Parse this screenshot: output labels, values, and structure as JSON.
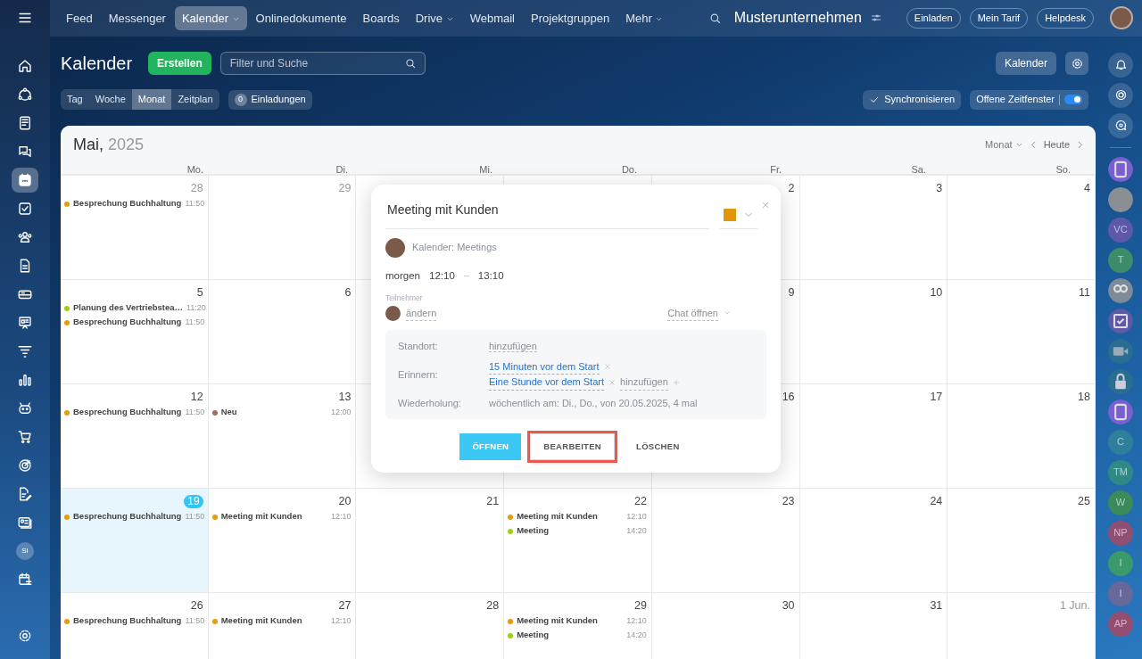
{
  "left_sidebar": {
    "items": [
      {
        "kind": "menu",
        "selected": false
      },
      {
        "kind": "home",
        "selected": false
      },
      {
        "kind": "nodes",
        "selected": false
      },
      {
        "kind": "news",
        "selected": false
      },
      {
        "kind": "chat",
        "selected": false
      },
      {
        "kind": "calendar",
        "selected": true
      },
      {
        "kind": "tasks",
        "selected": false
      },
      {
        "kind": "people",
        "selected": false
      },
      {
        "kind": "document",
        "selected": false
      },
      {
        "kind": "drive",
        "selected": false
      },
      {
        "kind": "board",
        "selected": false
      },
      {
        "kind": "funnel",
        "selected": false
      },
      {
        "kind": "chart",
        "selected": false
      },
      {
        "kind": "robot",
        "selected": false
      },
      {
        "kind": "cart",
        "selected": false
      },
      {
        "kind": "target",
        "selected": false
      },
      {
        "kind": "sign",
        "selected": false
      },
      {
        "kind": "idcard",
        "selected": false
      },
      {
        "kind": "avatar",
        "initials": "SI",
        "selected": false
      },
      {
        "kind": "callist",
        "selected": false
      },
      {
        "kind": "settings",
        "selected": false
      }
    ]
  },
  "top_nav": {
    "items": [
      {
        "label": "Feed",
        "selected": false,
        "dropdown": false
      },
      {
        "label": "Messenger",
        "selected": false,
        "dropdown": false
      },
      {
        "label": "Kalender",
        "selected": true,
        "dropdown": true
      },
      {
        "label": "Onlinedokumente",
        "selected": false,
        "dropdown": false
      },
      {
        "label": "Boards",
        "selected": false,
        "dropdown": false
      },
      {
        "label": "Drive",
        "selected": false,
        "dropdown": true
      },
      {
        "label": "Webmail",
        "selected": false,
        "dropdown": false
      },
      {
        "label": "Projektgruppen",
        "selected": false,
        "dropdown": false
      },
      {
        "label": "Mehr",
        "selected": false,
        "dropdown": true
      }
    ],
    "company": "Musterunternehmen",
    "buttons": [
      "Einladen",
      "Mein Tarif",
      "Helpdesk"
    ]
  },
  "header": {
    "title": "Kalender",
    "create_button": "Erstellen",
    "search": {
      "placeholder": "Filter und Suche"
    },
    "calendar_button": "Kalender"
  },
  "view_tabs": [
    {
      "label": "Tag",
      "selected": false
    },
    {
      "label": "Woche",
      "selected": false
    },
    {
      "label": "Monat",
      "selected": true
    },
    {
      "label": "Zeitplan",
      "selected": false
    }
  ],
  "invitations": {
    "count": "0",
    "label": "Einladungen"
  },
  "sync_button": "Synchronisieren",
  "open_slots": {
    "label": "Offene Zeitfenster",
    "on": true
  },
  "calendar": {
    "month": "Mai,",
    "year": "2025",
    "view_select": "Monat",
    "today_button": "Heute",
    "weekdays": [
      "Mo.",
      "Di.",
      "Mi.",
      "Do.",
      "Fr.",
      "Sa.",
      "So."
    ],
    "weeks": [
      [
        {
          "day": "28",
          "other_month": true,
          "today": false,
          "events": [
            {
              "title": "Besprechung Buchhaltung",
              "time": "11:50",
              "color": "#e89c0c"
            }
          ]
        },
        {
          "day": "29",
          "other_month": true,
          "today": false
        },
        {
          "day": "2",
          "other_month": false,
          "today": false
        },
        {
          "day": "3",
          "other_month": false,
          "today": false
        },
        {
          "day": "4",
          "other_month": false,
          "today": false
        }
      ],
      [
        {
          "day": "5",
          "other_month": false,
          "today": false,
          "events": [
            {
              "title": "Planung des Vertriebstea…",
              "time": "11:20",
              "color": "#9bd10f"
            },
            {
              "title": "Besprechung Buchhaltung",
              "time": "11:50",
              "color": "#e89c0c"
            }
          ]
        },
        {
          "day": "6",
          "other_month": false,
          "today": false
        },
        {
          "day": "9",
          "other_month": false,
          "today": false
        },
        {
          "day": "10",
          "other_month": false,
          "today": false
        },
        {
          "day": "11",
          "other_month": false,
          "today": false
        }
      ],
      [
        {
          "day": "12",
          "other_month": false,
          "today": false,
          "events": [
            {
              "title": "Besprechung Buchhaltung",
              "time": "11:50",
              "color": "#e89c0c"
            }
          ]
        },
        {
          "day": "13",
          "other_month": false,
          "today": false,
          "events": [
            {
              "title": "Neu",
              "time": "12:00",
              "color": "#a86b55"
            }
          ]
        },
        {
          "day": "16",
          "other_month": false,
          "today": false
        },
        {
          "day": "17",
          "other_month": false,
          "today": false
        },
        {
          "day": "18",
          "other_month": false,
          "today": false
        }
      ],
      [
        {
          "day": "19",
          "other_month": false,
          "today": true,
          "events": [
            {
              "title": "Besprechung Buchhaltung",
              "time": "11:50",
              "color": "#e89c0c"
            }
          ]
        },
        {
          "day": "20",
          "other_month": false,
          "today": false,
          "events": [
            {
              "title": "Meeting mit Kunden",
              "time": "12:10",
              "color": "#e89c0c"
            }
          ]
        },
        {
          "day": "21",
          "other_month": false,
          "today": false
        },
        {
          "day": "22",
          "other_month": false,
          "today": false,
          "events": [
            {
              "title": "Meeting mit Kunden",
              "time": "12:10",
              "color": "#e89c0c"
            },
            {
              "title": "Meeting",
              "time": "14:20",
              "color": "#9bd10f"
            }
          ]
        },
        {
          "day": "23",
          "other_month": false,
          "today": false
        },
        {
          "day": "24",
          "other_month": false,
          "today": false
        },
        {
          "day": "25",
          "other_month": false,
          "today": false
        }
      ],
      [
        {
          "day": "26",
          "other_month": false,
          "today": false,
          "events": [
            {
              "title": "Besprechung Buchhaltung",
              "time": "11:50",
              "color": "#e89c0c"
            }
          ]
        },
        {
          "day": "27",
          "other_month": false,
          "today": false,
          "events": [
            {
              "title": "Meeting mit Kunden",
              "time": "12:10",
              "color": "#e89c0c"
            }
          ]
        },
        {
          "day": "28",
          "other_month": false,
          "today": false
        },
        {
          "day": "29",
          "other_month": false,
          "today": false,
          "events": [
            {
              "title": "Meeting mit Kunden",
              "time": "12:10",
              "color": "#e89c0c"
            },
            {
              "title": "Meeting",
              "time": "14:20",
              "color": "#9bd10f"
            }
          ]
        },
        {
          "day": "30",
          "other_month": false,
          "today": false
        },
        {
          "day": "31",
          "other_month": false,
          "today": false
        },
        {
          "day": "1 Jun.",
          "other_month": true,
          "today": false
        }
      ]
    ]
  },
  "popup": {
    "title": "Meeting mit Kunden",
    "color": "#e0960a",
    "calendar_label": "Kalender: Meetings",
    "date": "morgen",
    "start": "12:10",
    "end": "13:10",
    "participants_label": "Teilnehmer",
    "participant_action": "ändern",
    "chat_button": "Chat öffnen",
    "location": {
      "label": "Standort:",
      "value": "hinzufügen"
    },
    "reminders": {
      "label": "Erinnern:",
      "items": [
        "15 Minuten vor dem Start",
        "Eine Stunde vor dem Start"
      ],
      "add": "hinzufügen"
    },
    "repeat": {
      "label": "Wiederholung:",
      "value": "wöchentlich am: Di., Do., von 20.05.2025, 4 mal"
    },
    "buttons": [
      {
        "label": "ÖFFNEN",
        "kind": "primary",
        "highlighted": false
      },
      {
        "label": "BEARBEITEN",
        "kind": "secondary",
        "highlighted": true
      },
      {
        "label": "LÖSCHEN",
        "kind": "link",
        "highlighted": false
      }
    ]
  },
  "right_sidebar": {
    "items": [
      {
        "kind": "bell"
      },
      {
        "kind": "spiral"
      },
      {
        "kind": "chatsearch"
      },
      {
        "kind": "book",
        "color": "#7a5fd0"
      },
      {
        "kind": "photo",
        "color": "#8a8f96"
      },
      {
        "kind": "initials",
        "initials": "VC",
        "color": "#5e58a8"
      },
      {
        "kind": "initials",
        "initials": "T",
        "color": "#3c8c6a"
      },
      {
        "kind": "group",
        "color": "#7d8a98"
      },
      {
        "kind": "check",
        "color": "#5e58a8"
      },
      {
        "kind": "video",
        "color": "#2a6d90"
      },
      {
        "kind": "lock",
        "color": "#2a6d90"
      },
      {
        "kind": "book",
        "color": "#7a5fd0"
      },
      {
        "kind": "initials",
        "initials": "C",
        "color": "#2e7f9c"
      },
      {
        "kind": "initials",
        "initials": "TM",
        "color": "#2f8a86"
      },
      {
        "kind": "initials",
        "initials": "W",
        "color": "#3a8a5c"
      },
      {
        "kind": "initials",
        "initials": "NP",
        "color": "#8f4f72"
      },
      {
        "kind": "initials",
        "initials": "I",
        "color": "#3a9a6c"
      },
      {
        "kind": "initials",
        "initials": "I",
        "color": "#66699a"
      },
      {
        "kind": "initials",
        "initials": "AP",
        "color": "#944e70"
      }
    ]
  }
}
